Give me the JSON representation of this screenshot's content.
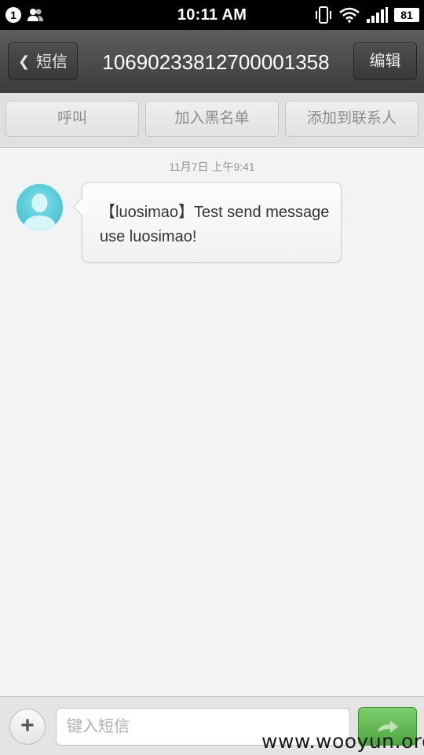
{
  "status_bar": {
    "notification_count": "1",
    "time": "10:11 AM",
    "battery": "81",
    "icons": [
      "notification-badge-icon",
      "people-icon",
      "vibrate-icon",
      "wifi-icon",
      "signal-icon",
      "battery-icon"
    ]
  },
  "header": {
    "back_label": "短信",
    "title": "10690233812700001358",
    "edit_label": "编辑"
  },
  "actions": {
    "call_label": "呼叫",
    "blacklist_label": "加入黑名单",
    "add_contact_label": "添加到联系人"
  },
  "conversation": {
    "timestamp": "11月7日 上午9:41",
    "messages": [
      {
        "text": "【luosimao】Test send message use luosimao!"
      }
    ]
  },
  "input_bar": {
    "placeholder": "键入短信",
    "value": ""
  },
  "watermark": "www.wooyun.org",
  "colors": {
    "header_bg": "#4a4a4a",
    "send_button": "#5cb34d",
    "avatar": "#5ccad8"
  }
}
